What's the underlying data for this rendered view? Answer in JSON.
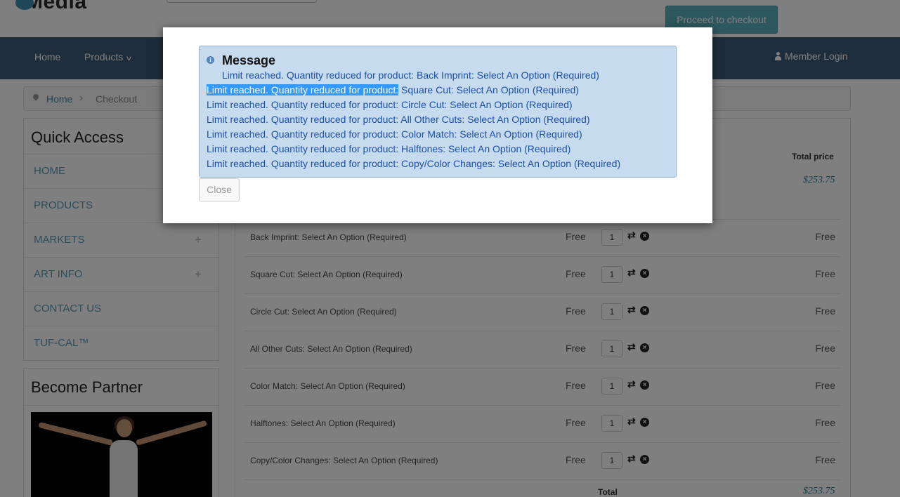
{
  "header": {
    "logo_text": "Media",
    "checkout_button": "Proceed to checkout"
  },
  "nav": {
    "items": [
      "Home",
      "Products"
    ],
    "login": "Member Login"
  },
  "breadcrumb": {
    "home": "Home",
    "current": "Checkout"
  },
  "sidebar": {
    "title": "Quick Access",
    "links": [
      {
        "label": "HOME",
        "expandable": false
      },
      {
        "label": "PRODUCTS",
        "expandable": false
      },
      {
        "label": "MARKETS",
        "expandable": true
      },
      {
        "label": "ART INFO",
        "expandable": true
      },
      {
        "label": "CONTACT US",
        "expandable": false
      },
      {
        "label": "TUF-CAL™",
        "expandable": false
      }
    ],
    "partner_title": "Become Partner"
  },
  "cart": {
    "total_header": "Total price",
    "top_total": "$253.75",
    "rows": [
      {
        "name": "Back Imprint: Select An Option (Required)",
        "price": "Free",
        "qty": "1",
        "total": "Free"
      },
      {
        "name": "Square Cut: Select An Option (Required)",
        "price": "Free",
        "qty": "1",
        "total": "Free"
      },
      {
        "name": "Circle Cut: Select An Option (Required)",
        "price": "Free",
        "qty": "1",
        "total": "Free"
      },
      {
        "name": "All Other Cuts: Select An Option (Required)",
        "price": "Free",
        "qty": "1",
        "total": "Free"
      },
      {
        "name": "Color Match: Select An Option (Required)",
        "price": "Free",
        "qty": "1",
        "total": "Free"
      },
      {
        "name": "Halftones: Select An Option (Required)",
        "price": "Free",
        "qty": "1",
        "total": "Free"
      },
      {
        "name": "Copy/Color Changes: Select An Option (Required)",
        "price": "Free",
        "qty": "1",
        "total": "Free"
      }
    ],
    "total_label": "Total",
    "bottom_total": "$253.75"
  },
  "modal": {
    "title": "Message",
    "line_prefix": "Limit reached. Quantity reduced for product:",
    "lines": [
      "Back Imprint: Select An Option (Required)",
      "Square Cut: Select An Option (Required)",
      "Circle Cut: Select An Option (Required)",
      "All Other Cuts: Select An Option (Required)",
      "Color Match: Select An Option (Required)",
      "Halftones: Select An Option (Required)",
      "Copy/Color Changes: Select An Option (Required)"
    ],
    "close_button": "Close"
  }
}
